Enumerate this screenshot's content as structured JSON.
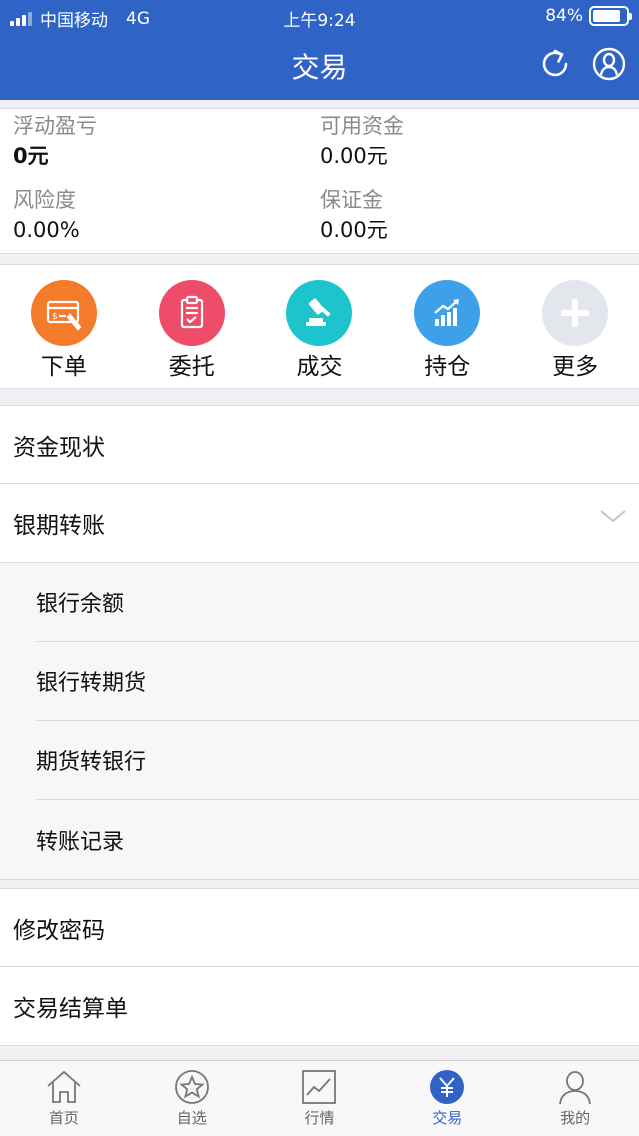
{
  "status_bar": {
    "carrier": "中国移动",
    "network": "4G",
    "time": "上午9:24",
    "battery": "84%",
    "battery_level": 0.84
  },
  "nav": {
    "title": "交易",
    "refresh_icon": "refresh-icon",
    "user_icon": "user-circle-icon"
  },
  "account": {
    "floating_pl": {
      "label": "浮动盈亏",
      "value": "0元"
    },
    "available_funds": {
      "label": "可用资金",
      "value": "0.00元"
    },
    "risk": {
      "label": "风险度",
      "value": "0.00%"
    },
    "margin": {
      "label": "保证金",
      "value": "0.00元"
    }
  },
  "actions": [
    {
      "label": "下单",
      "icon": "order-ticket-icon",
      "color": "#f47b2a"
    },
    {
      "label": "委托",
      "icon": "clipboard-icon",
      "color": "#ee4d6a"
    },
    {
      "label": "成交",
      "icon": "gavel-icon",
      "color": "#1dc4cc"
    },
    {
      "label": "持仓",
      "icon": "bar-chart-icon",
      "color": "#3fa0ea"
    },
    {
      "label": "更多",
      "icon": "plus-icon",
      "color": "#e3e6ec"
    }
  ],
  "menu": {
    "funds_status": "资金现状",
    "bank_futures_transfer": "银期转账",
    "transfer_sub": [
      "银行余额",
      "银行转期货",
      "期货转银行",
      "转账记录"
    ],
    "change_password": "修改密码",
    "settlement": "交易结算单"
  },
  "tabs": [
    {
      "label": "首页",
      "icon": "home-icon"
    },
    {
      "label": "自选",
      "icon": "star-icon"
    },
    {
      "label": "行情",
      "icon": "trend-chart-icon"
    },
    {
      "label": "交易",
      "icon": "yuan-icon",
      "active": true
    },
    {
      "label": "我的",
      "icon": "person-icon"
    }
  ],
  "colors": {
    "primary": "#2f64c6",
    "background": "#efeff4"
  }
}
